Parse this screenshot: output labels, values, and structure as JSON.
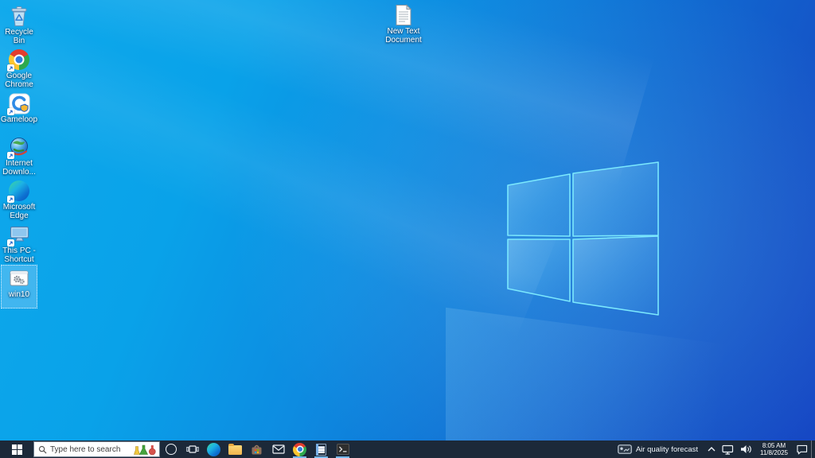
{
  "desktop": {
    "icons": [
      {
        "label": "Recycle Bin",
        "selected": false
      },
      {
        "label": "Google Chrome",
        "selected": false
      },
      {
        "label": "Gameloop",
        "selected": false
      },
      {
        "label": "Internet Downlo...",
        "selected": false
      },
      {
        "label": "Microsoft Edge",
        "selected": false
      },
      {
        "label": "This PC - Shortcut",
        "selected": false
      },
      {
        "label": "win10",
        "selected": true
      }
    ],
    "new_text_document": {
      "label": "New Text Document"
    }
  },
  "taskbar": {
    "search": {
      "placeholder": "Type here to search"
    },
    "buttons": [
      {
        "name": "start"
      },
      {
        "name": "cortana"
      },
      {
        "name": "task-view"
      },
      {
        "name": "microsoft-edge",
        "running": false
      },
      {
        "name": "file-explorer",
        "running": false
      },
      {
        "name": "microsoft-store",
        "running": false
      },
      {
        "name": "mail",
        "running": false
      },
      {
        "name": "google-chrome",
        "running": true
      },
      {
        "name": "notepad",
        "running": true
      },
      {
        "name": "command-prompt",
        "running": true
      }
    ],
    "tray": {
      "widget": {
        "label": "Air quality forecast"
      },
      "clock": {
        "time": "8:05 AM",
        "date": "11/8/2025"
      }
    }
  },
  "colors": {
    "taskbar_bg": "#1c2939",
    "running_indicator": "#76b9ed",
    "selection_highlight": "rgba(165,215,250,0.35)",
    "wallpaper_light": "#0aa6ea",
    "wallpaper_dark": "#1647c4",
    "logo_edge": "#7be8fd"
  }
}
